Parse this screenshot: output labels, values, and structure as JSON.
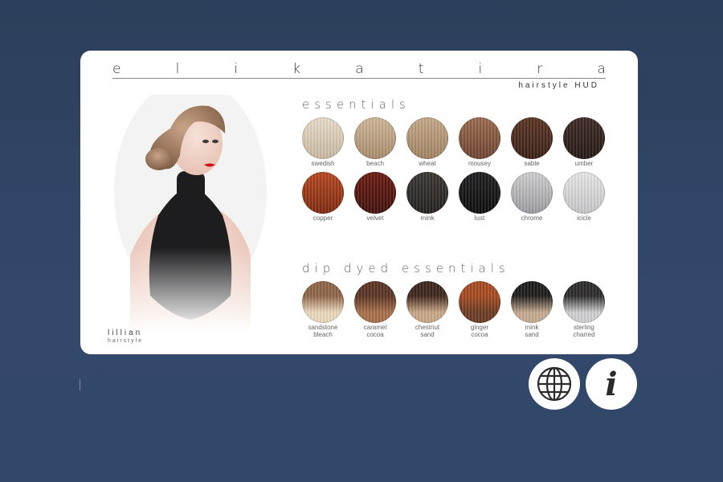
{
  "brand": {
    "letters": [
      "e",
      "l",
      "i",
      "k",
      "a",
      "t",
      "i",
      "r",
      "a"
    ],
    "subtitle": "hairstyle HUD"
  },
  "portrait": {
    "style_name": "lillian",
    "style_sub": "hairstyle"
  },
  "essentials": {
    "title": "essentials",
    "swatches": [
      {
        "label": "swedish",
        "color": "#e7dccb",
        "dark": "#c9b99f"
      },
      {
        "label": "beach",
        "color": "#d0b699",
        "dark": "#a88b6c"
      },
      {
        "label": "wheat",
        "color": "#c5a988",
        "dark": "#9f8262"
      },
      {
        "label": "mousey",
        "color": "#9a6a4f",
        "dark": "#6c4430"
      },
      {
        "label": "sable",
        "color": "#5a3424",
        "dark": "#3a2016"
      },
      {
        "label": "umber",
        "color": "#3e2a23",
        "dark": "#241815"
      },
      {
        "label": "copper",
        "color": "#b5471f",
        "dark": "#7d2a10"
      },
      {
        "label": "velvet",
        "color": "#6a1b12",
        "dark": "#40100a"
      },
      {
        "label": "mink",
        "color": "#3a3633",
        "dark": "#221f1d"
      },
      {
        "label": "lust",
        "color": "#1f1f21",
        "dark": "#0d0d0e"
      },
      {
        "label": "chrome",
        "color": "#cfcfd1",
        "dark": "#9c9ca0"
      },
      {
        "label": "icicle",
        "color": "#e6e6e6",
        "dark": "#c6c6c8"
      }
    ]
  },
  "dip_dyed": {
    "title": "dip dyed essentials",
    "swatches": [
      {
        "label": "sandstone\nbleach",
        "top": "#8d6447",
        "bottom": "#ead9bd"
      },
      {
        "label": "caramel\ncocoa",
        "top": "#5a3424",
        "bottom": "#a7704b"
      },
      {
        "label": "chestnut\nsand",
        "top": "#3d261c",
        "bottom": "#c9a888"
      },
      {
        "label": "ginger\ncocoa",
        "top": "#a64a22",
        "bottom": "#6a3a25"
      },
      {
        "label": "mink\nsand",
        "top": "#1e1b1b",
        "bottom": "#c5aa90"
      },
      {
        "label": "sterling\ncharred",
        "top": "#2d2b2b",
        "bottom": "#cfcfd1"
      }
    ]
  },
  "buttons": {
    "web": "globe-icon",
    "info": "info-icon",
    "info_glyph": "i"
  }
}
